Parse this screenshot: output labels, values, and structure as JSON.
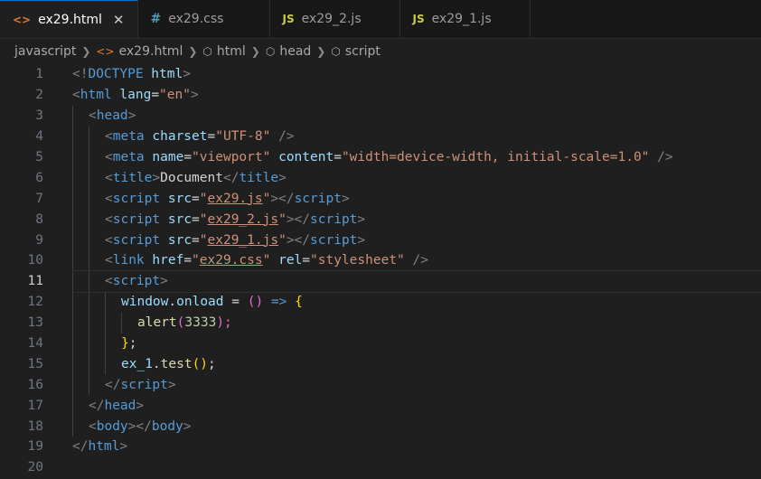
{
  "tabs": [
    {
      "icon": "<>",
      "label": "ex29.html",
      "active": true,
      "close": "✕",
      "icon_color": "#e37933"
    },
    {
      "icon": "#",
      "label": "ex29.css",
      "active": false,
      "icon_color": "#519aba"
    },
    {
      "icon": "JS",
      "label": "ex29_2.js",
      "active": false,
      "icon_color": "#cbcb41"
    },
    {
      "icon": "JS",
      "label": "ex29_1.js",
      "active": false,
      "icon_color": "#cbcb41"
    }
  ],
  "breadcrumb": [
    "javascript",
    "ex29.html",
    "html",
    "head",
    "script"
  ],
  "current_line": 11,
  "line_numbers": [
    "1",
    "2",
    "3",
    "4",
    "5",
    "6",
    "7",
    "8",
    "9",
    "10",
    "11",
    "12",
    "13",
    "14",
    "15",
    "16",
    "17",
    "18",
    "19",
    "20"
  ],
  "code": {
    "l1": [
      "<!",
      "DOCTYPE",
      " html",
      ">"
    ],
    "l2": [
      "<",
      "html",
      " lang",
      "=",
      "\"en\"",
      ">"
    ],
    "l3": [
      "<",
      "head",
      ">"
    ],
    "l4": [
      "<",
      "meta",
      " charset",
      "=",
      "\"UTF-8\"",
      " />"
    ],
    "l5": [
      "<",
      "meta",
      " name",
      "=",
      "\"viewport\"",
      " content",
      "=",
      "\"width=device-width, initial-scale=1.0\"",
      " />"
    ],
    "l6": [
      "<",
      "title",
      ">",
      "Document",
      "</",
      "title",
      ">"
    ],
    "l7": [
      "<",
      "script",
      " src",
      "=",
      "\"",
      "ex29.js",
      "\"",
      "></",
      "script",
      ">"
    ],
    "l8": [
      "<",
      "script",
      " src",
      "=",
      "\"",
      "ex29_2.js",
      "\"",
      "></",
      "script",
      ">"
    ],
    "l9": [
      "<",
      "script",
      " src",
      "=",
      "\"",
      "ex29_1.js",
      "\"",
      "></",
      "script",
      ">"
    ],
    "l10": [
      "<",
      "link",
      " href",
      "=",
      "\"",
      "ex29.css",
      "\"",
      " rel",
      "=",
      "\"stylesheet\"",
      " />"
    ],
    "l11": [
      "<",
      "script",
      ">"
    ],
    "l12": [
      "window",
      ".",
      "onload",
      " = ",
      "()",
      " => ",
      "{"
    ],
    "l13": [
      "alert",
      "(",
      "3333",
      ");"
    ],
    "l14": [
      "}",
      ";"
    ],
    "l15": [
      "ex_1",
      ".",
      "test",
      "()",
      ";"
    ],
    "l16": [
      "</",
      "script",
      ">"
    ],
    "l17": [
      "</",
      "head",
      ">"
    ],
    "l18": [
      "<",
      "body",
      "></",
      "body",
      ">"
    ],
    "l19": [
      "</",
      "html",
      ">"
    ],
    "l20": []
  }
}
